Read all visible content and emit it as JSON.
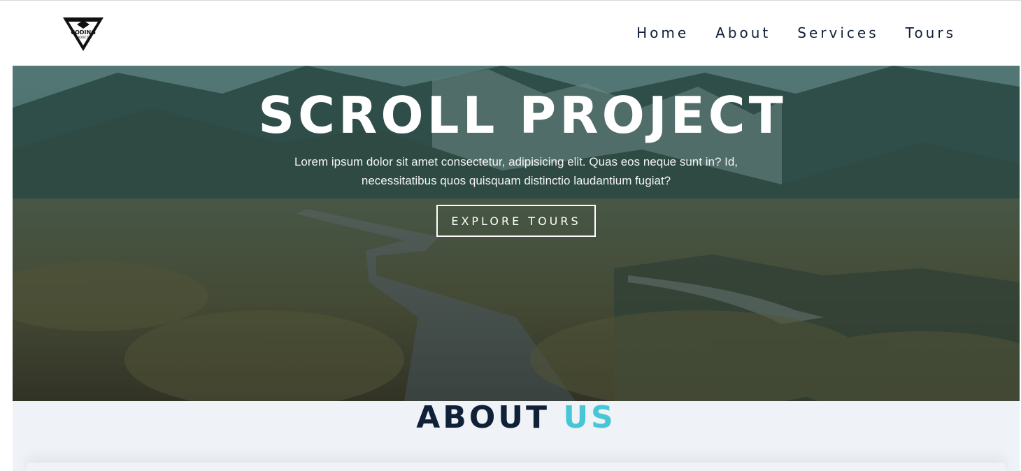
{
  "brand": {
    "logo_word": "CODING",
    "logo_subword": "ADDICT"
  },
  "nav": {
    "items": [
      {
        "label": "Home"
      },
      {
        "label": "About"
      },
      {
        "label": "Services"
      },
      {
        "label": "Tours"
      }
    ]
  },
  "hero": {
    "title": "SCROLL PROJECT",
    "text": "Lorem ipsum dolor sit amet consectetur, adipisicing elit. Quas eos neque sunt in? Id, necessitatibus quos quisquam distinctio laudantium fugiat?",
    "button_label": "EXPLORE TOURS"
  },
  "about": {
    "title_main": "ABOUT",
    "title_accent": "US"
  },
  "colors": {
    "navy": "#0f2038",
    "accent": "#47c6d6",
    "section_bg": "#eff3f7"
  }
}
